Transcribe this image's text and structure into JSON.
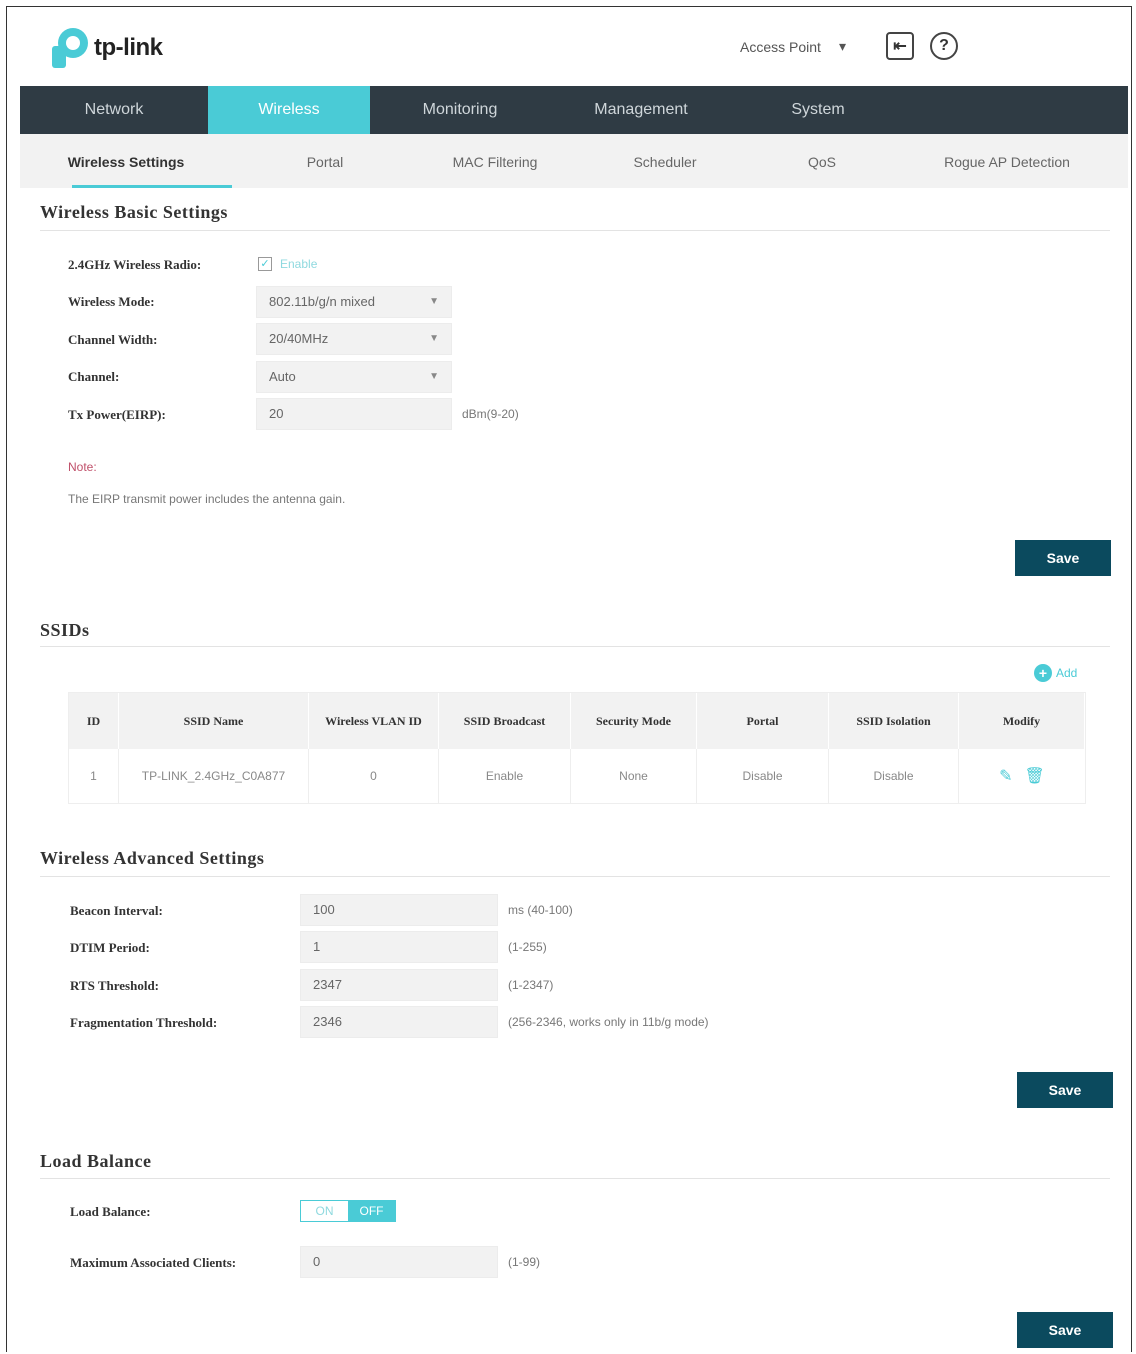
{
  "brand": {
    "logo_text": "tp-link",
    "accent": "#4acbd6",
    "nav_bg": "#2f3b44",
    "button_bg": "#0b4a5e"
  },
  "header": {
    "mode": "Access Point",
    "mode_caret": "▾",
    "logout_icon": "logout-icon",
    "help_icon": "help-icon"
  },
  "main_nav": [
    "Network",
    "Wireless",
    "Monitoring",
    "Management",
    "System"
  ],
  "main_nav_active": "Wireless",
  "sub_nav": [
    "Wireless Settings",
    "Portal",
    "MAC Filtering",
    "Scheduler",
    "QoS",
    "Rogue AP Detection"
  ],
  "sub_nav_active": "Wireless Settings",
  "basic": {
    "title": "Wireless Basic Settings",
    "radio_label": "2.4GHz Wireless Radio:",
    "radio_value": "Enable",
    "mode_label": "Wireless Mode:",
    "mode_value": "802.11b/g/n mixed",
    "width_label": "Channel Width:",
    "width_value": "20/40MHz",
    "channel_label": "Channel:",
    "channel_value": "Auto",
    "power_label": "Tx Power(EIRP):",
    "power_value": "20",
    "power_hint": "dBm(9-20)",
    "note_label": "Note:",
    "note_text": "The EIRP transmit power includes the antenna gain.",
    "save": "Save"
  },
  "ssids": {
    "title": "SSIDs",
    "add": "Add",
    "headers": [
      "ID",
      "SSID Name",
      "Wireless VLAN ID",
      "SSID Broadcast",
      "Security Mode",
      "Portal",
      "SSID Isolation",
      "Modify"
    ],
    "rows": [
      [
        "1",
        "TP-LINK_2.4GHz_C0A877",
        "0",
        "Enable",
        "None",
        "Disable",
        "Disable"
      ]
    ]
  },
  "advanced": {
    "title": "Wireless Advanced Settings",
    "beacon_label": "Beacon Interval:",
    "beacon_value": "100",
    "beacon_hint": "ms (40-100)",
    "dtim_label": "DTIM Period:",
    "dtim_value": "1",
    "dtim_hint": "(1-255)",
    "rts_label": "RTS Threshold:",
    "rts_value": "2347",
    "rts_hint": "(1-2347)",
    "frag_label": "Fragmentation Threshold:",
    "frag_value": "2346",
    "frag_hint": "(256-2346, works only in 11b/g mode)",
    "save": "Save"
  },
  "load": {
    "title": "Load Balance",
    "lb_label": "Load Balance:",
    "on": "ON",
    "off": "OFF",
    "max_label": "Maximum Associated Clients:",
    "max_value": "0",
    "max_hint": "(1-99)",
    "save": "Save"
  }
}
